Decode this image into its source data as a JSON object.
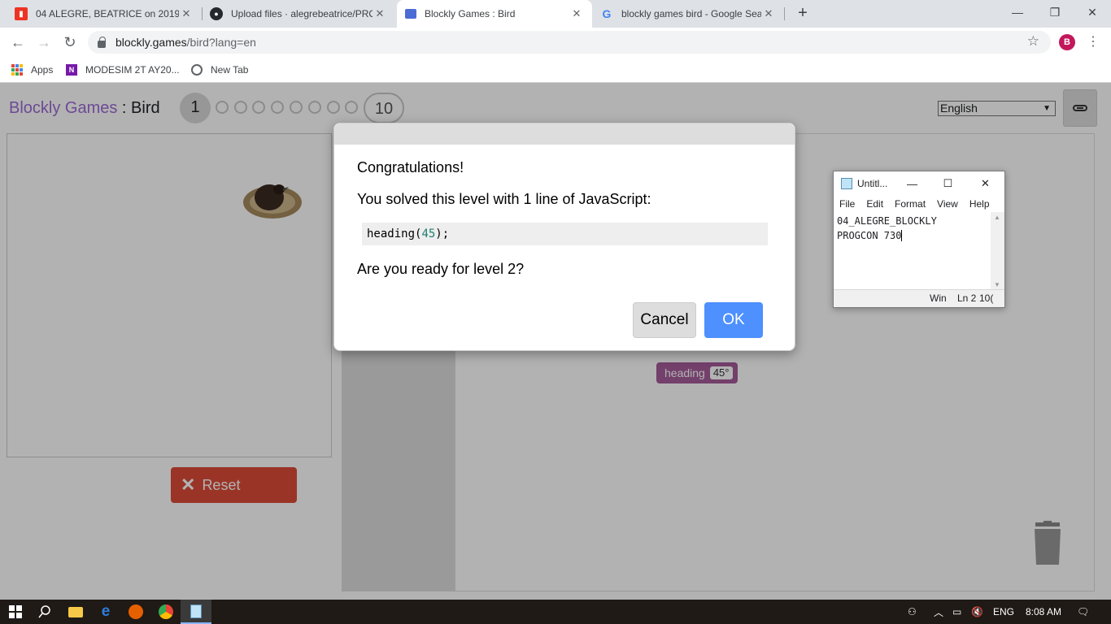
{
  "browser": {
    "tabs": [
      {
        "title": "04 ALEGRE, BEATRICE on 2019T2"
      },
      {
        "title": "Upload files · alegrebeatrice/PRO"
      },
      {
        "title": "Blockly Games : Bird"
      },
      {
        "title": "blockly games bird - Google Sea"
      }
    ],
    "url_host": "blockly.games",
    "url_path": "/bird?lang=en",
    "profile_initial": "B",
    "bookmarks": [
      {
        "label": "Apps"
      },
      {
        "label": "MODESIM 2T AY20..."
      },
      {
        "label": "New Tab"
      }
    ]
  },
  "game": {
    "title_link": "Blockly Games",
    "title_sep": " : ",
    "title_level": "Bird",
    "current_level": "1",
    "last_level": "10",
    "language": "English",
    "reset_label": "Reset",
    "block": {
      "label": "heading",
      "value": "45°"
    }
  },
  "dialog": {
    "line1": "Congratulations!",
    "line2": "You solved this level with 1 line of JavaScript:",
    "code_fn": "heading(",
    "code_num": "45",
    "code_end": ");",
    "line3": "Are you ready for level 2?",
    "cancel": "Cancel",
    "ok": "OK"
  },
  "notepad": {
    "title": "Untitl...",
    "menu": [
      "File",
      "Edit",
      "Format",
      "View",
      "Help"
    ],
    "line1": "04_ALEGRE_BLOCKLY",
    "line2": "PROGCON 730",
    "status_enc": "Win",
    "status_pos": "Ln 2",
    "status_zoom": "10("
  },
  "taskbar": {
    "lang": "ENG",
    "time": "8:08 AM"
  },
  "colors": {
    "accent_purple": "#9c6ad6",
    "block_purple": "#a55b9a",
    "reset_red": "#dd4b39",
    "ok_blue": "#4d90fe"
  }
}
